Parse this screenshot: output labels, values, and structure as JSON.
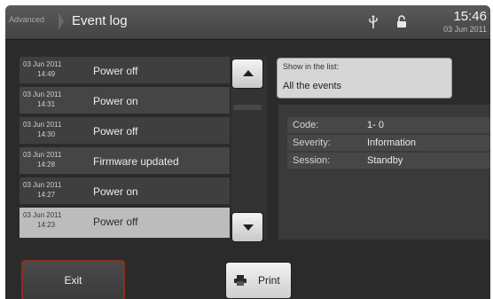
{
  "header": {
    "breadcrumb": "Advanced",
    "title": "Event log",
    "time": "15:46",
    "date": "03 Jun 2011",
    "icons": [
      "usb-icon",
      "lock-icon"
    ]
  },
  "events": [
    {
      "date": "03 Jun 2011",
      "time": "14:49",
      "label": "Power off"
    },
    {
      "date": "03 Jun 2011",
      "time": "14:31",
      "label": "Power on"
    },
    {
      "date": "03 Jun 2011",
      "time": "14:30",
      "label": "Power off"
    },
    {
      "date": "03 Jun 2011",
      "time": "14:28",
      "label": "Firmware updated"
    },
    {
      "date": "03 Jun 2011",
      "time": "14:27",
      "label": "Power on"
    },
    {
      "date": "03 Jun 2011",
      "time": "14:23",
      "label": "Power off",
      "selected": true
    }
  ],
  "filter": {
    "label": "Show in the list:",
    "value": "All the events"
  },
  "details": {
    "code_label": "Code:",
    "code_value": "1- 0",
    "severity_label": "Severity:",
    "severity_value": "Information",
    "session_label": "Session:",
    "session_value": "Standby"
  },
  "buttons": {
    "exit_label": "Exit",
    "print_label": "Print"
  },
  "colors": {
    "exit_border": "#8a2f1f",
    "selected_row": "#bcbcbc"
  }
}
